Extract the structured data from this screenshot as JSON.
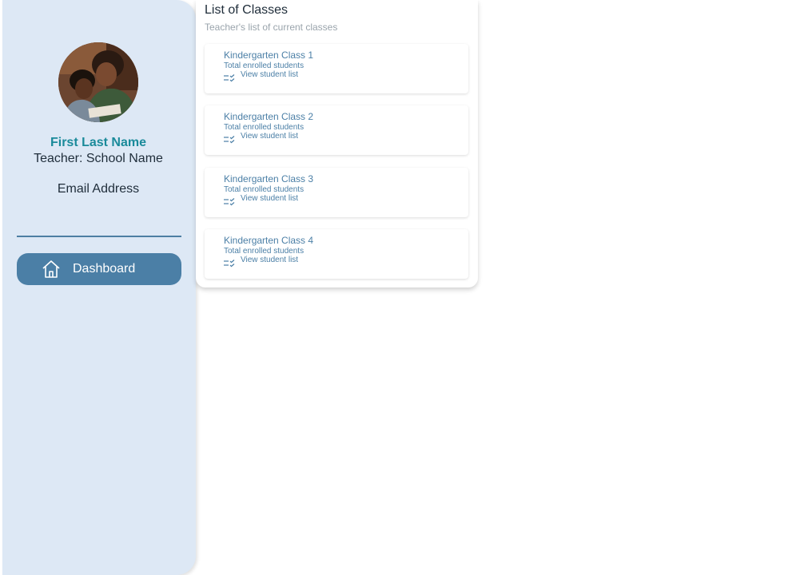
{
  "profile": {
    "name": "First Last Name",
    "school": "Teacher: School Name",
    "email": "Email Address"
  },
  "nav": {
    "dashboard_label": "Dashboard",
    "dashboard_icon": "home-icon"
  },
  "panel": {
    "title": "List of Classes",
    "subtitle": "Teacher's list of current classes"
  },
  "classes": [
    {
      "title": "Kindergarten Class 1",
      "subtitle": "Total enrolled students",
      "link": "View student list"
    },
    {
      "title": "Kindergarten Class 2",
      "subtitle": "Total enrolled students",
      "link": "View student list"
    },
    {
      "title": "Kindergarten Class 3",
      "subtitle": "Total enrolled students",
      "link": "View student list"
    },
    {
      "title": "Kindergarten Class 4",
      "subtitle": "Total enrolled students",
      "link": "View student list"
    }
  ],
  "colors": {
    "sidebar_bg": "#dde8f5",
    "accent": "#4b7fa6",
    "name_color": "#1a8a9a"
  }
}
